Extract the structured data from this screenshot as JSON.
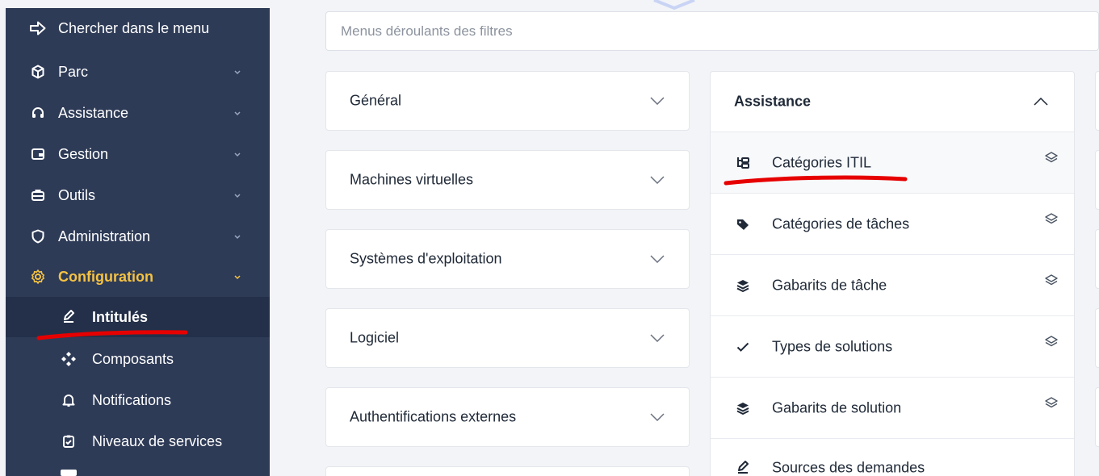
{
  "sidebar": {
    "search_label": "Chercher dans le menu",
    "items": [
      {
        "label": "Parc",
        "icon": "cube-icon"
      },
      {
        "label": "Assistance",
        "icon": "headset-icon"
      },
      {
        "label": "Gestion",
        "icon": "wallet-icon"
      },
      {
        "label": "Outils",
        "icon": "briefcase-icon"
      },
      {
        "label": "Administration",
        "icon": "shield-icon"
      },
      {
        "label": "Configuration",
        "icon": "settings-icon",
        "active": true
      }
    ],
    "subitems": [
      {
        "label": "Intitulés",
        "icon": "edit-icon",
        "current": true
      },
      {
        "label": "Composants",
        "icon": "components-icon"
      },
      {
        "label": "Notifications",
        "icon": "bell-icon"
      },
      {
        "label": "Niveaux de services",
        "icon": "clipboard-check-icon"
      }
    ]
  },
  "main": {
    "filter_placeholder": "Menus déroulants des filtres",
    "accordions": [
      {
        "title": "Général"
      },
      {
        "title": "Machines virtuelles"
      },
      {
        "title": "Systèmes d'exploitation"
      },
      {
        "title": "Logiciel"
      },
      {
        "title": "Authentifications externes"
      }
    ],
    "assistance_panel": {
      "title": "Assistance",
      "items": [
        {
          "label": "Catégories ITIL",
          "icon": "hierarchy-icon"
        },
        {
          "label": "Catégories de tâches",
          "icon": "tags-icon"
        },
        {
          "label": "Gabarits de tâche",
          "icon": "layers-icon"
        },
        {
          "label": "Types de solutions",
          "icon": "check-icon"
        },
        {
          "label": "Gabarits de solution",
          "icon": "layers-icon"
        },
        {
          "label": "Sources des demandes",
          "icon": "edit-icon"
        }
      ]
    }
  },
  "colors": {
    "sidebar_bg": "#2e3b57",
    "sidebar_current_bg": "#243049",
    "active_accent": "#f5c242",
    "annotation_red": "#e60000",
    "page_bg": "#f2f4f7"
  }
}
